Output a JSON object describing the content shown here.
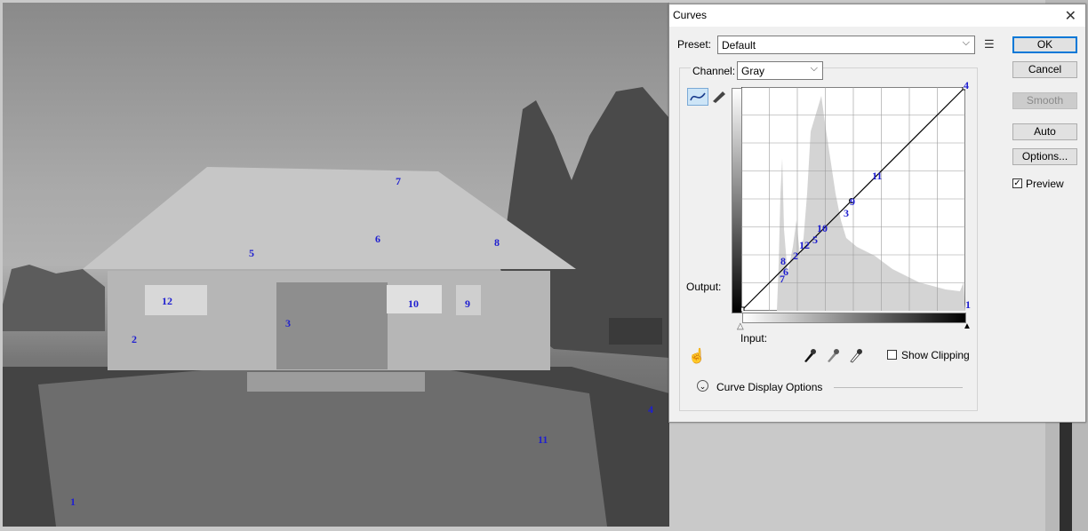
{
  "photo_markers": [
    {
      "label": "1"
    },
    {
      "label": "2"
    },
    {
      "label": "3"
    },
    {
      "label": "4"
    },
    {
      "label": "5"
    },
    {
      "label": "6"
    },
    {
      "label": "7"
    },
    {
      "label": "8"
    },
    {
      "label": "9"
    },
    {
      "label": "10"
    },
    {
      "label": "11"
    },
    {
      "label": "12"
    }
  ],
  "dialog": {
    "title": "Curves",
    "preset_label": "Preset:",
    "preset_value": "Default",
    "channel_label": "Channel:",
    "channel_value": "Gray",
    "output_label": "Output:",
    "input_label": "Input:",
    "show_clipping_label": "Show Clipping",
    "show_clipping_checked": false,
    "curve_display_options_label": "Curve Display Options",
    "buttons": {
      "ok": "OK",
      "cancel": "Cancel",
      "smooth": "Smooth",
      "auto": "Auto",
      "options": "Options..."
    },
    "preview_label": "Preview",
    "preview_checked": true,
    "curve_markers": [
      {
        "label": "4"
      },
      {
        "label": "11"
      },
      {
        "label": "9"
      },
      {
        "label": "3"
      },
      {
        "label": "10"
      },
      {
        "label": "5"
      },
      {
        "label": "12"
      },
      {
        "label": "2"
      },
      {
        "label": "8"
      },
      {
        "label": "6"
      },
      {
        "label": "7"
      },
      {
        "label": "1"
      }
    ]
  },
  "icons": {
    "curve_tool": "curve-tool-icon",
    "pencil_tool": "pencil-icon",
    "close": "close-icon",
    "preset_menu": "preset-menu-icon",
    "target_adjust": "target-adjust-hand-icon",
    "eyedropper_black": "black-eyedropper-icon",
    "eyedropper_gray": "gray-eyedropper-icon",
    "eyedropper_white": "white-eyedropper-icon",
    "expand": "expand-chevron-icon"
  },
  "colors": {
    "marker": "#1f1fd0",
    "accent": "#0078d7",
    "histogram": "#d4d4d4"
  }
}
